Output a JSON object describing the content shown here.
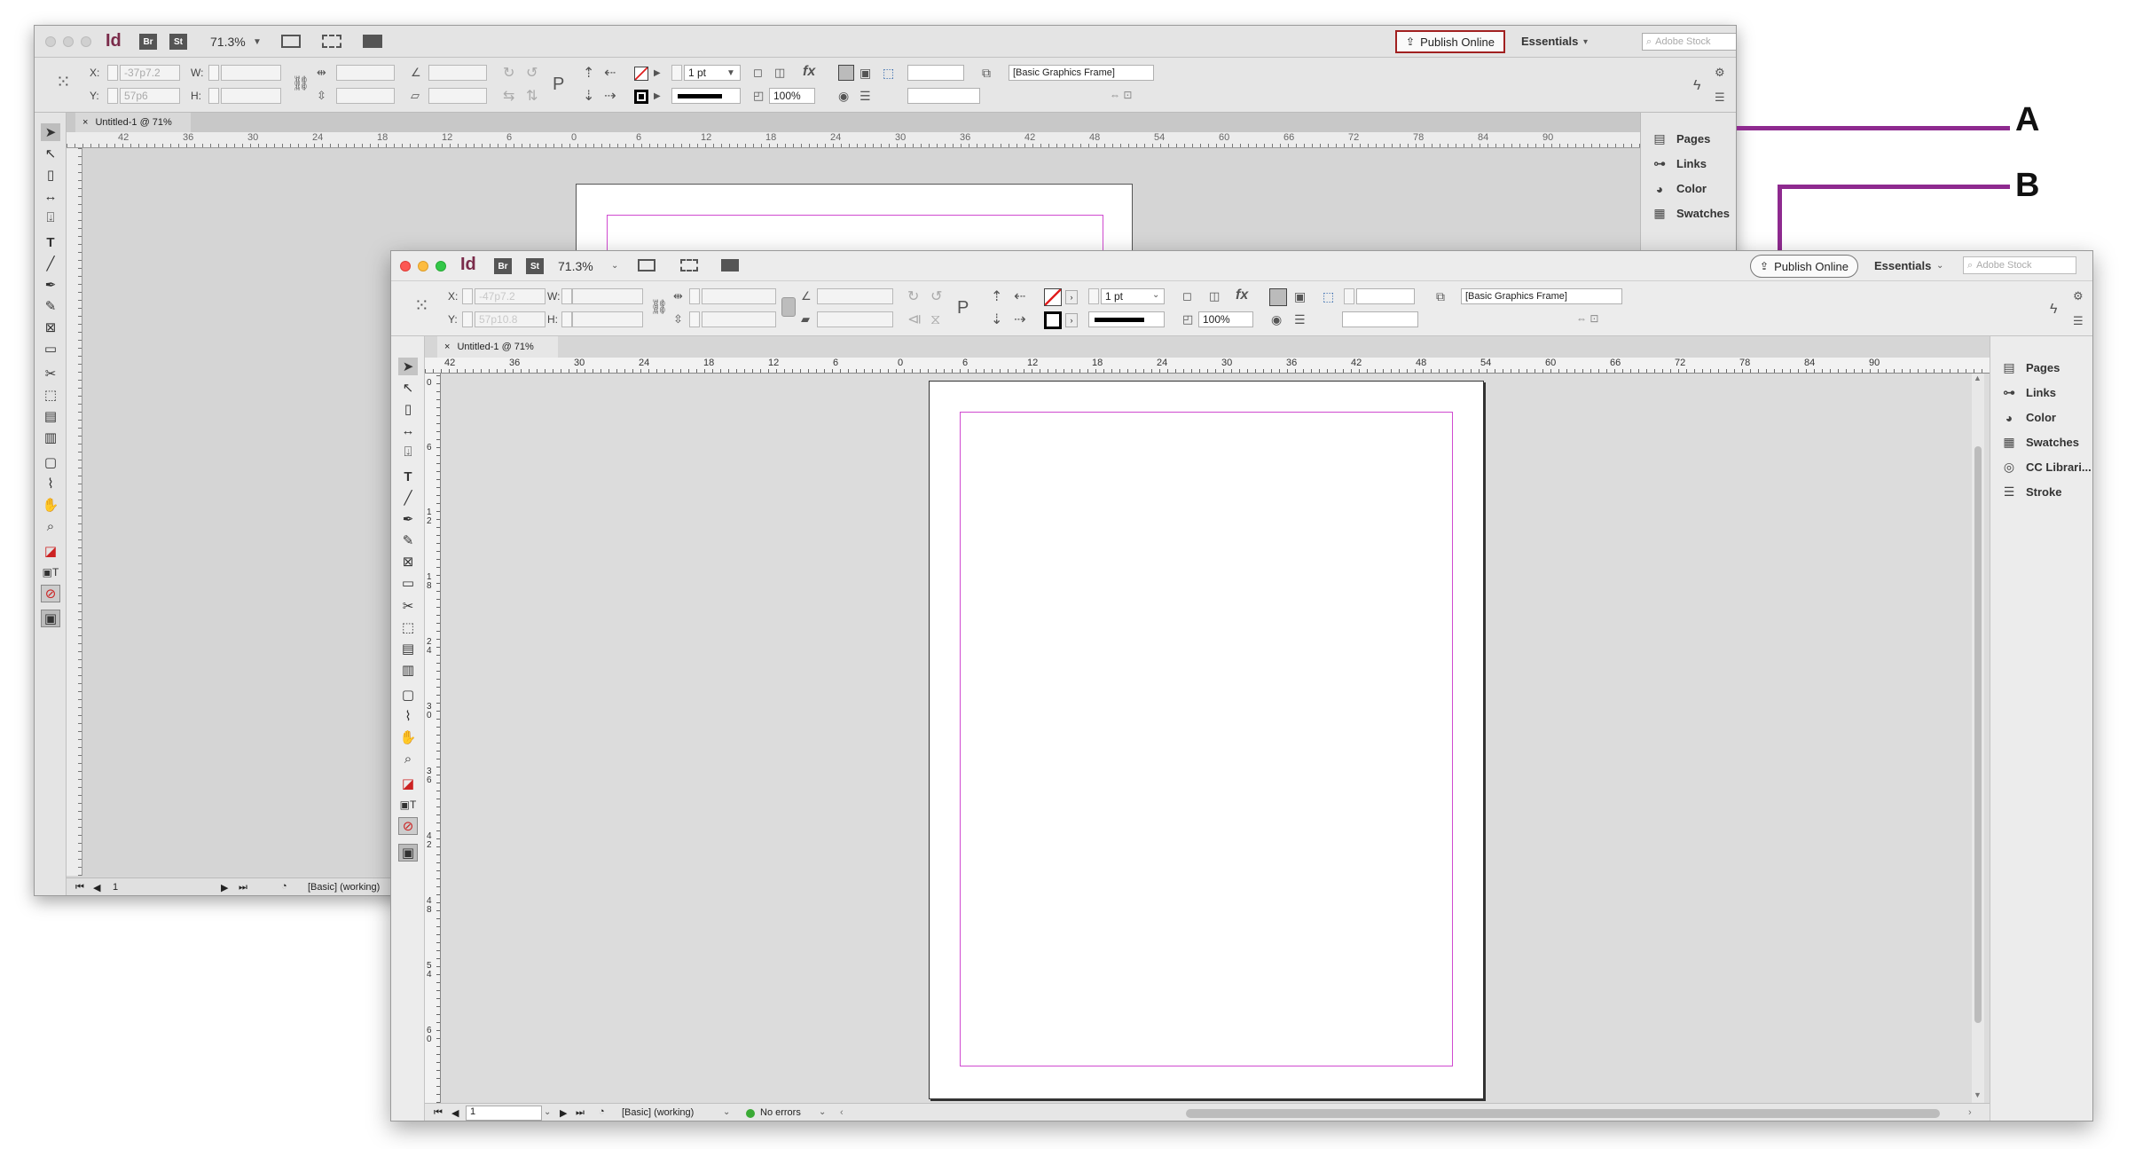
{
  "callouts": {
    "a": "A",
    "b": "B"
  },
  "colors": {
    "callout_line": "#8e2a8f",
    "margin_guide": "#d04ad0",
    "status_ok": "#3aaa35",
    "publish_border_back": "#a12020"
  },
  "back_window": {
    "app_badge": "Id",
    "bridge_label": "Br",
    "stock_label": "St",
    "zoom": "71.3%",
    "publish_label": "Publish Online",
    "workspace_label": "Essentials",
    "search_placeholder": "Adobe Stock",
    "x_label": "X:",
    "y_label": "Y:",
    "w_label": "W:",
    "h_label": "H:",
    "x_value": "-37p7.2",
    "y_value": "57p6",
    "stroke_weight": "1 pt",
    "opacity": "100%",
    "object_style": "[Basic Graphics Frame]",
    "tab_title": "Untitled-1 @ 71%",
    "ruler_labels": [
      "42",
      "36",
      "30",
      "24",
      "18",
      "12",
      "6",
      "0",
      "6",
      "12",
      "18",
      "24",
      "30",
      "36",
      "42",
      "48",
      "54",
      "60",
      "66",
      "72",
      "78",
      "84",
      "90"
    ],
    "page_number": "1",
    "preflight_profile": "[Basic] (working)",
    "panels": [
      {
        "label": "Pages",
        "icon": "pages-icon"
      },
      {
        "label": "Links",
        "icon": "links-icon"
      },
      {
        "label": "Color",
        "icon": "color-icon"
      },
      {
        "label": "Swatches",
        "icon": "swatches-icon"
      }
    ]
  },
  "front_window": {
    "app_badge": "Id",
    "bridge_label": "Br",
    "stock_label": "St",
    "zoom": "71.3%",
    "publish_label": "Publish Online",
    "workspace_label": "Essentials",
    "search_placeholder": "Adobe Stock",
    "x_label": "X:",
    "y_label": "Y:",
    "w_label": "W:",
    "h_label": "H:",
    "x_value": "-47p7.2",
    "y_value": "57p10.8",
    "stroke_weight": "1 pt",
    "opacity": "100%",
    "object_style": "[Basic Graphics Frame]",
    "tab_title": "Untitled-1 @ 71%",
    "ruler_labels": [
      "42",
      "36",
      "30",
      "24",
      "18",
      "12",
      "6",
      "0",
      "6",
      "12",
      "18",
      "24",
      "30",
      "36",
      "42",
      "48",
      "54",
      "60",
      "66",
      "72",
      "78",
      "84",
      "90"
    ],
    "vruler_labels": [
      "0",
      "6",
      "1 2",
      "1 8",
      "2 4",
      "3 0",
      "3 6",
      "4 2",
      "4 8",
      "5 4",
      "6 0"
    ],
    "page_number": "1",
    "preflight_profile": "[Basic] (working)",
    "errors_label": "No errors",
    "panels": [
      {
        "label": "Pages",
        "icon": "pages-icon"
      },
      {
        "label": "Links",
        "icon": "links-icon"
      },
      {
        "label": "Color",
        "icon": "color-icon"
      },
      {
        "label": "Swatches",
        "icon": "swatches-icon"
      },
      {
        "label": "CC Librari...",
        "icon": "cc-libraries-icon"
      },
      {
        "label": "Stroke",
        "icon": "stroke-icon"
      }
    ]
  }
}
